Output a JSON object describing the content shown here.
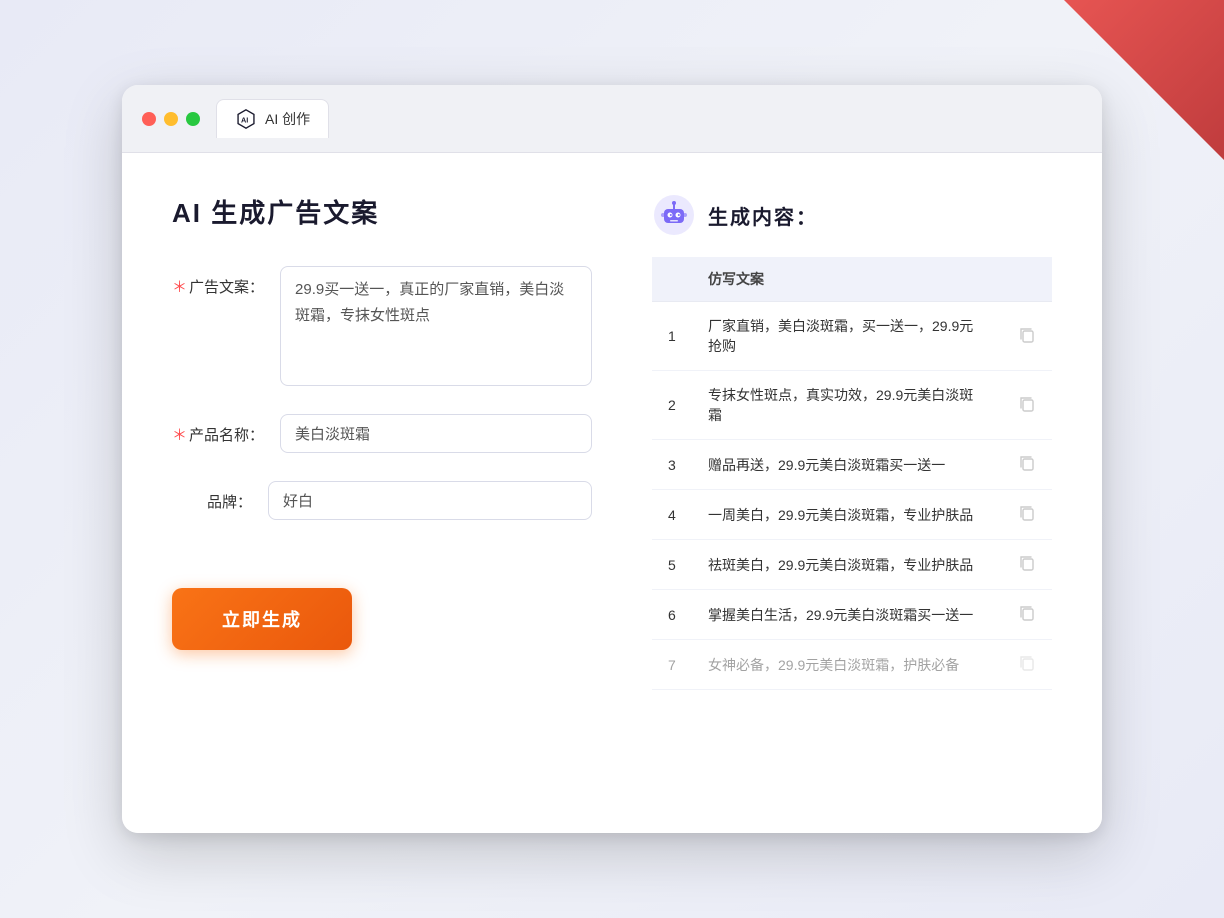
{
  "decoration": {
    "corner": true
  },
  "browser": {
    "traffic_lights": [
      "red",
      "yellow",
      "green"
    ],
    "tab": {
      "label": "AI 创作",
      "icon": "ai-icon"
    }
  },
  "left_panel": {
    "page_title": "AI 生成广告文案",
    "form": {
      "ad_copy_label": "广告文案：",
      "ad_copy_required": "＊",
      "ad_copy_value": "29.9买一送一，真正的厂家直销，美白淡斑霜，专抹女性斑点",
      "product_name_label": "产品名称：",
      "product_name_required": "＊",
      "product_name_value": "美白淡斑霜",
      "brand_label": "品牌：",
      "brand_value": "好白"
    },
    "generate_button": "立即生成"
  },
  "right_panel": {
    "output_title": "生成内容：",
    "table": {
      "column_header": "仿写文案",
      "rows": [
        {
          "num": "1",
          "text": "厂家直销，美白淡斑霜，买一送一，29.9元抢购"
        },
        {
          "num": "2",
          "text": "专抹女性斑点，真实功效，29.9元美白淡斑霜"
        },
        {
          "num": "3",
          "text": "赠品再送，29.9元美白淡斑霜买一送一"
        },
        {
          "num": "4",
          "text": "一周美白，29.9元美白淡斑霜，专业护肤品"
        },
        {
          "num": "5",
          "text": "祛斑美白，29.9元美白淡斑霜，专业护肤品"
        },
        {
          "num": "6",
          "text": "掌握美白生活，29.9元美白淡斑霜买一送一"
        },
        {
          "num": "7",
          "text": "女神必备，29.9元美白淡斑霜，护肤必备"
        }
      ]
    }
  }
}
